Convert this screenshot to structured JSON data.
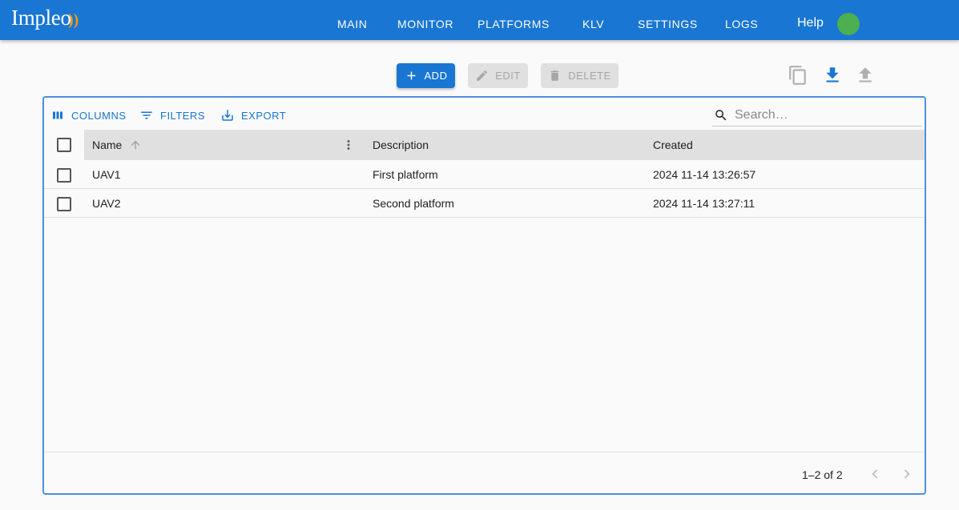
{
  "app": {
    "logo": "Impleo",
    "logo_mark": "))"
  },
  "nav": {
    "main": "MAIN",
    "monitor": "MONITOR",
    "platforms": "PLATFORMS",
    "klv": "KLV",
    "settings": "SETTINGS",
    "logs": "LOGS",
    "help": "Help"
  },
  "actions": {
    "add": "ADD",
    "edit": "EDIT",
    "delete": "DELETE"
  },
  "toolbar": {
    "columns": "COLUMNS",
    "filters": "FILTERS",
    "export": "EXPORT",
    "search_placeholder": "Search…"
  },
  "table": {
    "columns": [
      "Name",
      "Description",
      "Created"
    ],
    "rows": [
      {
        "name": "UAV1",
        "description": "First platform",
        "created": "2024 11-14 13:26:57"
      },
      {
        "name": "UAV2",
        "description": "Second platform",
        "created": "2024 11-14 13:27:11"
      }
    ]
  },
  "pagination": {
    "range": "1–2 of 2"
  },
  "colors": {
    "primary": "#1976d2",
    "status": "#4caf50",
    "logo_accent": "#f39c12"
  },
  "icons": {
    "add": "plus-icon",
    "edit": "pencil-icon",
    "delete": "trash-icon",
    "copy": "copy-icon",
    "download": "download-icon",
    "upload": "upload-icon",
    "columns": "columns-icon",
    "filters": "filter-icon",
    "export": "export-icon",
    "search": "search-icon",
    "sort": "arrow-up-icon",
    "column_menu": "more-vertical-icon"
  }
}
